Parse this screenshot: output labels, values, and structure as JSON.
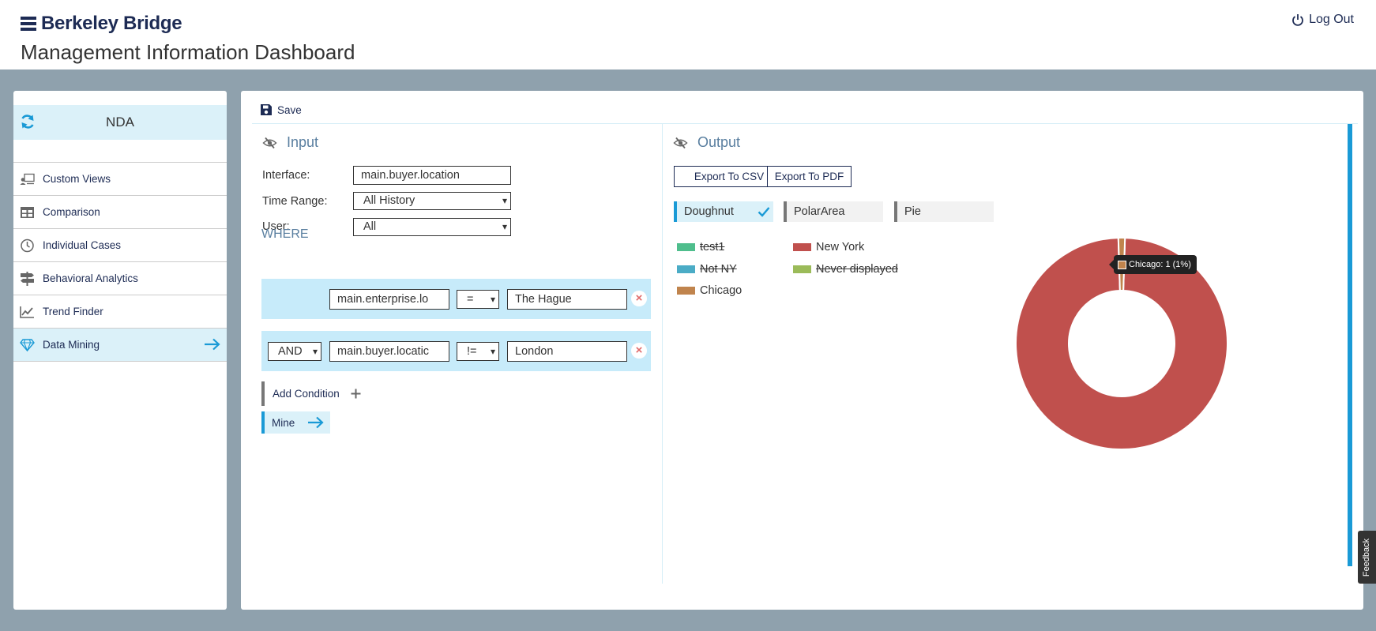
{
  "header": {
    "brand": "Berkeley Bridge",
    "title": "Management Information Dashboard",
    "logout_label": "Log Out"
  },
  "sidebar": {
    "project": "NDA",
    "items": [
      {
        "label": "Custom Views",
        "icon": "custom-views-icon"
      },
      {
        "label": "Comparison",
        "icon": "table-icon"
      },
      {
        "label": "Individual Cases",
        "icon": "clock-icon"
      },
      {
        "label": "Behavioral Analytics",
        "icon": "signpost-icon"
      },
      {
        "label": "Trend Finder",
        "icon": "line-chart-icon"
      },
      {
        "label": "Data Mining",
        "icon": "diamond-icon",
        "active": true
      }
    ]
  },
  "toolbar": {
    "save_label": "Save"
  },
  "input": {
    "heading": "Input",
    "interface_label": "Interface:",
    "interface_value": "main.buyer.location",
    "time_range_label": "Time Range:",
    "time_range_value": "All History",
    "user_label": "User:",
    "user_value": "All",
    "where_label": "WHERE",
    "conditions": [
      {
        "field": "main.enterprise.lo",
        "operator": "=",
        "value": "The Hague"
      },
      {
        "conjunction": "AND",
        "field": "main.buyer.locatic",
        "operator": "!=",
        "value": "London"
      }
    ],
    "add_condition_label": "Add Condition",
    "mine_label": "Mine"
  },
  "output": {
    "heading": "Output",
    "export_csv_label": "Export To CSV",
    "export_pdf_label": "Export To PDF",
    "chart_tabs": [
      {
        "label": "Doughnut",
        "active": true
      },
      {
        "label": "PolarArea",
        "active": false
      },
      {
        "label": "Pie",
        "active": false
      }
    ]
  },
  "chart_data": {
    "type": "pie",
    "variant": "doughnut",
    "title": "",
    "series": [
      {
        "name": "test1",
        "value": 0,
        "color": "#4fbe8d",
        "hidden": true
      },
      {
        "name": "New York",
        "value": 99,
        "color": "#c0504d",
        "hidden": false
      },
      {
        "name": "Not NY",
        "value": 0,
        "color": "#4bacc6",
        "hidden": true
      },
      {
        "name": "Never displayed",
        "value": 0,
        "color": "#9bbb59",
        "hidden": true
      },
      {
        "name": "Chicago",
        "value": 1,
        "color": "#c0844d",
        "hidden": false
      }
    ],
    "tooltip": {
      "label": "Chicago: 1 (1%)"
    },
    "legend_position": "top-left"
  },
  "colors": {
    "accent": "#1a9ad6",
    "brand": "#1d2b54",
    "highlight": "#dbf1f9"
  },
  "feedback_label": "Feedback"
}
